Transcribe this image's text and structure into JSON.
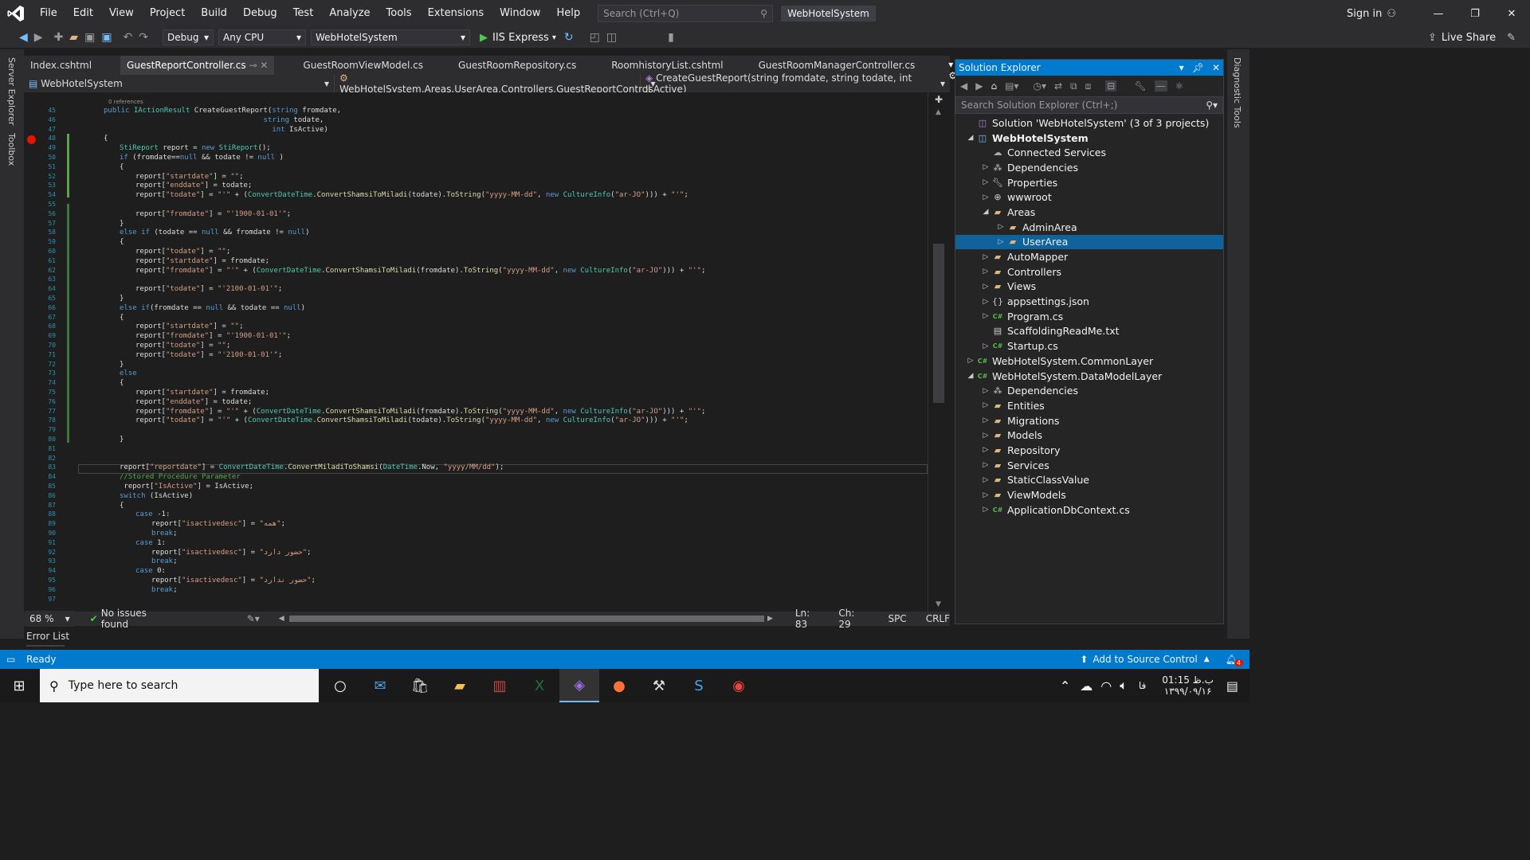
{
  "titlebar": {
    "menu": [
      "File",
      "Edit",
      "View",
      "Project",
      "Build",
      "Debug",
      "Test",
      "Analyze",
      "Tools",
      "Extensions",
      "Window",
      "Help"
    ],
    "search_placeholder": "Search (Ctrl+Q)",
    "solution_name": "WebHotelSystem",
    "sign_in": "Sign in"
  },
  "toolbar": {
    "config": "Debug",
    "platform": "Any CPU",
    "startup_project": "WebHotelSystem",
    "run_target": "IIS Express",
    "live_share": "Live Share"
  },
  "left_rail": {
    "server_explorer": "Server Explorer",
    "toolbox": "Toolbox"
  },
  "right_rail": {
    "diagnostic": "Diagnostic Tools"
  },
  "tabs": [
    {
      "label": "Index.cshtml",
      "active": false
    },
    {
      "label": "GuestReportController.cs",
      "active": true
    },
    {
      "label": "GuestRoomViewModel.cs",
      "active": false
    },
    {
      "label": "GuestRoomRepository.cs",
      "active": false
    },
    {
      "label": "RoomhistoryList.cshtml",
      "active": false
    },
    {
      "label": "GuestRoomManagerController.cs",
      "active": false
    }
  ],
  "navbar": {
    "project": "WebHotelSystem",
    "class": "WebHotelSystem.Areas.UserArea.Controllers.GuestReportControl",
    "member": "CreateGuestReport(string fromdate, string todate, int IsActive)"
  },
  "code": {
    "references": "0 references",
    "lines": [
      {
        "n": "45",
        "t": "public IActionResult CreateGuestReport(string fromdate,",
        "i": 0
      },
      {
        "n": "46",
        "t": "                                     string todate,",
        "i": 0
      },
      {
        "n": "47",
        "t": "                                       int IsActive)",
        "i": 0
      },
      {
        "n": "48",
        "t": "{",
        "i": 0
      },
      {
        "n": "49",
        "t": "StiReport report = new StiReport();",
        "i": 1
      },
      {
        "n": "50",
        "t": "if (fromdate==null && todate != null )",
        "i": 1
      },
      {
        "n": "51",
        "t": "{",
        "i": 1
      },
      {
        "n": "52",
        "t": "report[\"startdate\"] = \"\";",
        "i": 2
      },
      {
        "n": "53",
        "t": "report[\"enddate\"] = todate;",
        "i": 2
      },
      {
        "n": "54",
        "t": "report[\"todate\"] = \"'\" + (ConvertDateTime.ConvertShamsiToMiladi(todate).ToString(\"yyyy-MM-dd\", new CultureInfo(\"ar-JO\"))) + \"'\";",
        "i": 2
      },
      {
        "n": "55",
        "t": "",
        "i": 2
      },
      {
        "n": "56",
        "t": "report[\"fromdate\"] = \"'1900-01-01'\";",
        "i": 2
      },
      {
        "n": "57",
        "t": "}",
        "i": 1
      },
      {
        "n": "58",
        "t": "else if (todate == null && fromdate != null)",
        "i": 1
      },
      {
        "n": "59",
        "t": "{",
        "i": 1
      },
      {
        "n": "60",
        "t": "report[\"todate\"] = \"\";",
        "i": 2
      },
      {
        "n": "61",
        "t": "report[\"startdate\"] = fromdate;",
        "i": 2
      },
      {
        "n": "62",
        "t": "report[\"fromdate\"] = \"'\" + (ConvertDateTime.ConvertShamsiToMiladi(fromdate).ToString(\"yyyy-MM-dd\", new CultureInfo(\"ar-JO\"))) + \"'\";",
        "i": 2
      },
      {
        "n": "63",
        "t": "",
        "i": 2
      },
      {
        "n": "64",
        "t": "report[\"todate\"] = \"'2100-01-01'\";",
        "i": 2
      },
      {
        "n": "65",
        "t": "}",
        "i": 1
      },
      {
        "n": "66",
        "t": "else if(fromdate == null && todate == null)",
        "i": 1
      },
      {
        "n": "67",
        "t": "{",
        "i": 1
      },
      {
        "n": "68",
        "t": "report[\"startdate\"] = \"\";",
        "i": 2
      },
      {
        "n": "69",
        "t": "report[\"fromdate\"] = \"'1900-01-01'\";",
        "i": 2
      },
      {
        "n": "70",
        "t": "report[\"todate\"] = \"\";",
        "i": 2
      },
      {
        "n": "71",
        "t": "report[\"todate\"] = \"'2100-01-01'\";",
        "i": 2
      },
      {
        "n": "72",
        "t": "}",
        "i": 1
      },
      {
        "n": "73",
        "t": "else",
        "i": 1
      },
      {
        "n": "74",
        "t": "{",
        "i": 1
      },
      {
        "n": "75",
        "t": "report[\"startdate\"] = fromdate;",
        "i": 2
      },
      {
        "n": "76",
        "t": "report[\"enddate\"] = todate;",
        "i": 2
      },
      {
        "n": "77",
        "t": "report[\"fromdate\"] = \"'\" + (ConvertDateTime.ConvertShamsiToMiladi(fromdate).ToString(\"yyyy-MM-dd\", new CultureInfo(\"ar-JO\"))) + \"'\";",
        "i": 2
      },
      {
        "n": "78",
        "t": "report[\"todate\"] = \"'\" + (ConvertDateTime.ConvertShamsiToMiladi(todate).ToString(\"yyyy-MM-dd\", new CultureInfo(\"ar-JO\"))) + \"'\";",
        "i": 2
      },
      {
        "n": "79",
        "t": "",
        "i": 2
      },
      {
        "n": "80",
        "t": "}",
        "i": 1
      },
      {
        "n": "81",
        "t": "",
        "i": 1
      },
      {
        "n": "82",
        "t": "",
        "i": 1
      },
      {
        "n": "83",
        "t": "report[\"reportdate\"] = ConvertDateTime.ConvertMiladiToShamsi(DateTime.Now, \"yyyy/MM/dd\");",
        "i": 1
      },
      {
        "n": "84",
        "t": "//Stored Procedure Parameter",
        "i": 1
      },
      {
        "n": "85",
        "t": " report[\"IsActive\"] = IsActive;",
        "i": 1
      },
      {
        "n": "86",
        "t": "switch (IsActive)",
        "i": 1
      },
      {
        "n": "87",
        "t": "{",
        "i": 1
      },
      {
        "n": "88",
        "t": "case -1:",
        "i": 2
      },
      {
        "n": "89",
        "t": "report[\"isactivedesc\"] = \"همه\";",
        "i": 3
      },
      {
        "n": "90",
        "t": "break;",
        "i": 3
      },
      {
        "n": "91",
        "t": "case 1:",
        "i": 2
      },
      {
        "n": "92",
        "t": "report[\"isactivedesc\"] = \"حضور دارد\";",
        "i": 3
      },
      {
        "n": "93",
        "t": "break;",
        "i": 3
      },
      {
        "n": "94",
        "t": "case 0:",
        "i": 2
      },
      {
        "n": "95",
        "t": "report[\"isactivedesc\"] = \"حضور ندارد\";",
        "i": 3
      },
      {
        "n": "96",
        "t": "break;",
        "i": 3
      },
      {
        "n": "97",
        "t": "",
        "i": 2
      }
    ]
  },
  "statusline": {
    "zoom": "68 %",
    "issues": "No issues found",
    "ln": "Ln: 83",
    "ch": "Ch: 29",
    "spc": "SPC",
    "crlf": "CRLF"
  },
  "error_list": "Error List",
  "solution_explorer": {
    "title": "Solution Explorer",
    "search_placeholder": "Search Solution Explorer (Ctrl+;)",
    "items": [
      {
        "label": "Solution 'WebHotelSystem' (3 of 3 projects)",
        "depth": 0,
        "exp": "",
        "icon": "solution-icon"
      },
      {
        "label": "WebHotelSystem",
        "depth": 0,
        "exp": "◢",
        "icon": "project-icon",
        "bold": true
      },
      {
        "label": "Connected Services",
        "depth": 1,
        "exp": "",
        "icon": "connected-services-icon"
      },
      {
        "label": "Dependencies",
        "depth": 1,
        "exp": "▷",
        "icon": "dependencies-icon"
      },
      {
        "label": "Properties",
        "depth": 1,
        "exp": "▷",
        "icon": "wrench-icon"
      },
      {
        "label": "wwwroot",
        "depth": 1,
        "exp": "▷",
        "icon": "globe-icon"
      },
      {
        "label": "Areas",
        "depth": 1,
        "exp": "◢",
        "icon": "folder-open-icon"
      },
      {
        "label": "AdminArea",
        "depth": 2,
        "exp": "▷",
        "icon": "folder-icon"
      },
      {
        "label": "UserArea",
        "depth": 2,
        "exp": "▷",
        "icon": "folder-icon",
        "selected": true
      },
      {
        "label": "AutoMapper",
        "depth": 1,
        "exp": "▷",
        "icon": "folder-icon"
      },
      {
        "label": "Controllers",
        "depth": 1,
        "exp": "▷",
        "icon": "folder-icon"
      },
      {
        "label": "Views",
        "depth": 1,
        "exp": "▷",
        "icon": "folder-icon"
      },
      {
        "label": "appsettings.json",
        "depth": 1,
        "exp": "▷",
        "icon": "json-file-icon"
      },
      {
        "label": "Program.cs",
        "depth": 1,
        "exp": "▷",
        "icon": "csharp-file-icon"
      },
      {
        "label": "ScaffoldingReadMe.txt",
        "depth": 1,
        "exp": "",
        "icon": "text-file-icon"
      },
      {
        "label": "Startup.cs",
        "depth": 1,
        "exp": "▷",
        "icon": "csharp-file-icon"
      },
      {
        "label": "WebHotelSystem.CommonLayer",
        "depth": 0,
        "exp": "▷",
        "icon": "csharp-project-icon"
      },
      {
        "label": "WebHotelSystem.DataModelLayer",
        "depth": 0,
        "exp": "◢",
        "icon": "csharp-project-icon"
      },
      {
        "label": "Dependencies",
        "depth": 1,
        "exp": "▷",
        "icon": "dependencies-icon"
      },
      {
        "label": "Entities",
        "depth": 1,
        "exp": "▷",
        "icon": "folder-icon"
      },
      {
        "label": "Migrations",
        "depth": 1,
        "exp": "▷",
        "icon": "folder-icon"
      },
      {
        "label": "Models",
        "depth": 1,
        "exp": "▷",
        "icon": "folder-icon"
      },
      {
        "label": "Repository",
        "depth": 1,
        "exp": "▷",
        "icon": "folder-icon"
      },
      {
        "label": "Services",
        "depth": 1,
        "exp": "▷",
        "icon": "folder-icon"
      },
      {
        "label": "StaticClassValue",
        "depth": 1,
        "exp": "▷",
        "icon": "folder-icon"
      },
      {
        "label": "ViewModels",
        "depth": 1,
        "exp": "▷",
        "icon": "folder-icon"
      },
      {
        "label": "ApplicationDbContext.cs",
        "depth": 1,
        "exp": "▷",
        "icon": "csharp-file-icon"
      }
    ]
  },
  "statusbar": {
    "ready": "Ready",
    "source_control": "Add to Source Control",
    "notifications": "4"
  },
  "taskbar": {
    "search_placeholder": "Type here to search",
    "apps": [
      "cortana-icon",
      "mail-icon",
      "store-icon",
      "file-explorer-icon",
      "winrar-icon",
      "excel-icon",
      "visual-studio-icon",
      "firefox-icon",
      "tools-icon",
      "stimulsoft-icon",
      "chrome-icon"
    ],
    "lang": "فا",
    "time": "01:15 ب.ظ",
    "date": "۱۳۹۹/۰۹/۱۶"
  },
  "colors": {
    "accent": "#007acc",
    "selection": "#0e639c",
    "background": "#1e1e1e",
    "chrome": "#2d2d30"
  }
}
